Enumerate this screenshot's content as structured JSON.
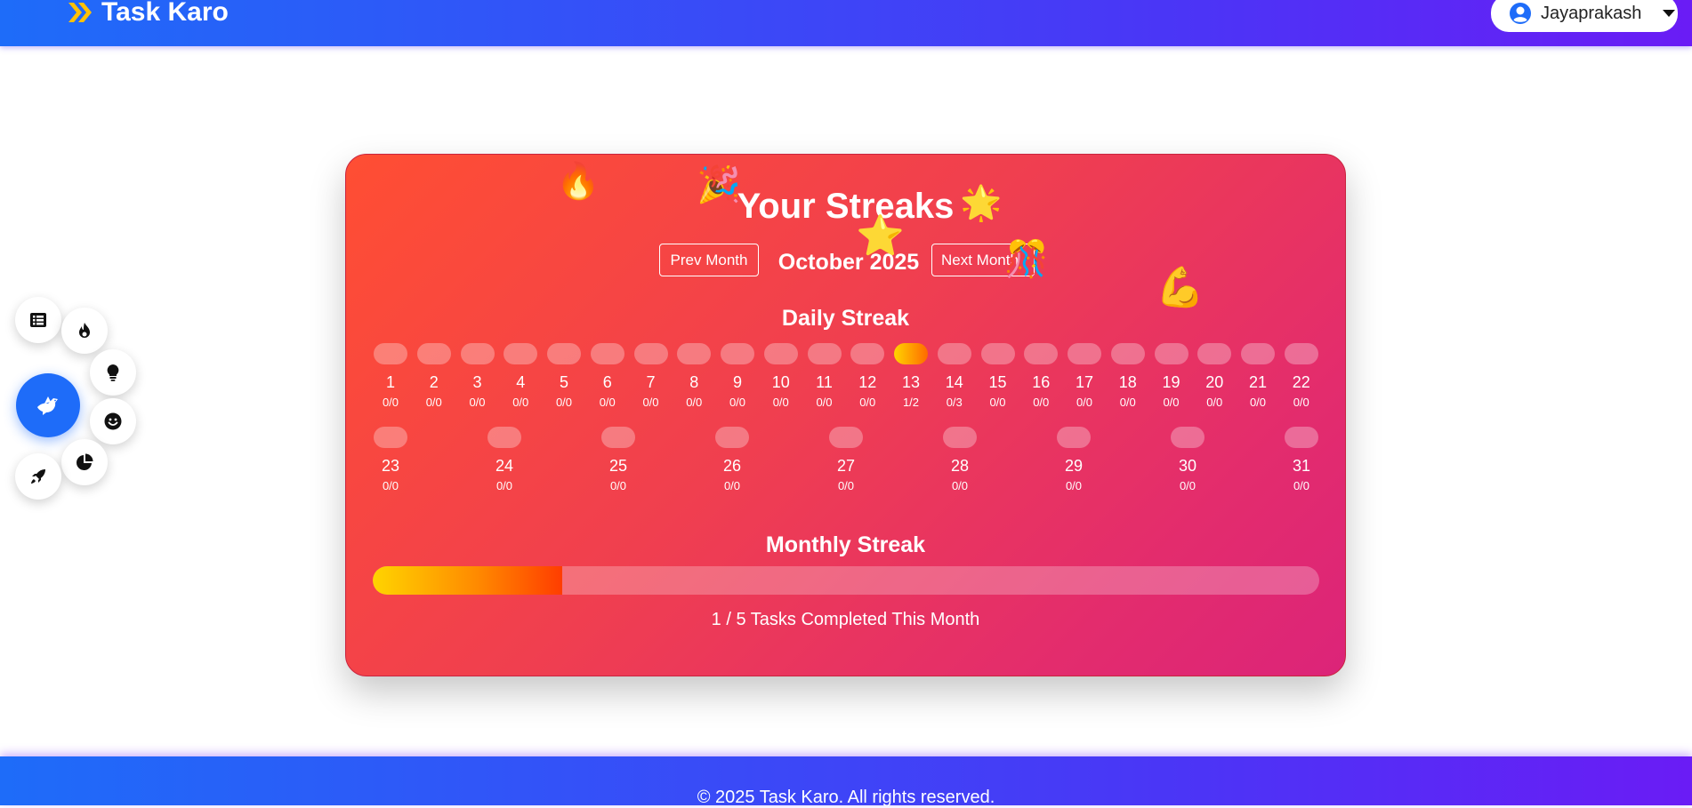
{
  "header": {
    "brand": "Task Karo",
    "user_name": "Jayaprakash",
    "icons": {
      "logo": "chevrons-logo-icon",
      "user": "user-circle-icon",
      "dropdown": "caret-down-icon"
    }
  },
  "streaks": {
    "title": "Your Streaks",
    "prev_label": "Prev Month",
    "next_label": "Next Month",
    "month_label": "October 2025",
    "daily_title": "Daily Streak",
    "monthly_title": "Monthly Streak",
    "days": [
      {
        "day": "1",
        "count": "0/0",
        "active": false
      },
      {
        "day": "2",
        "count": "0/0",
        "active": false
      },
      {
        "day": "3",
        "count": "0/0",
        "active": false
      },
      {
        "day": "4",
        "count": "0/0",
        "active": false
      },
      {
        "day": "5",
        "count": "0/0",
        "active": false
      },
      {
        "day": "6",
        "count": "0/0",
        "active": false
      },
      {
        "day": "7",
        "count": "0/0",
        "active": false
      },
      {
        "day": "8",
        "count": "0/0",
        "active": false
      },
      {
        "day": "9",
        "count": "0/0",
        "active": false
      },
      {
        "day": "10",
        "count": "0/0",
        "active": false
      },
      {
        "day": "11",
        "count": "0/0",
        "active": false
      },
      {
        "day": "12",
        "count": "0/0",
        "active": false
      },
      {
        "day": "13",
        "count": "1/2",
        "active": true
      },
      {
        "day": "14",
        "count": "0/3",
        "active": false
      },
      {
        "day": "15",
        "count": "0/0",
        "active": false
      },
      {
        "day": "16",
        "count": "0/0",
        "active": false
      },
      {
        "day": "17",
        "count": "0/0",
        "active": false
      },
      {
        "day": "18",
        "count": "0/0",
        "active": false
      },
      {
        "day": "19",
        "count": "0/0",
        "active": false
      },
      {
        "day": "20",
        "count": "0/0",
        "active": false
      },
      {
        "day": "21",
        "count": "0/0",
        "active": false
      },
      {
        "day": "22",
        "count": "0/0",
        "active": false
      },
      {
        "day": "23",
        "count": "0/0",
        "active": false
      },
      {
        "day": "24",
        "count": "0/0",
        "active": false
      },
      {
        "day": "25",
        "count": "0/0",
        "active": false
      },
      {
        "day": "26",
        "count": "0/0",
        "active": false
      },
      {
        "day": "27",
        "count": "0/0",
        "active": false
      },
      {
        "day": "28",
        "count": "0/0",
        "active": false
      },
      {
        "day": "29",
        "count": "0/0",
        "active": false
      },
      {
        "day": "30",
        "count": "0/0",
        "active": false
      },
      {
        "day": "31",
        "count": "0/0",
        "active": false
      }
    ],
    "monthly_completed": 1,
    "monthly_total": 5,
    "monthly_progress_fraction": 0.2,
    "monthly_text": "1 / 5 Tasks Completed This Month",
    "decorations": [
      "fire-emoji",
      "party-popper-emoji",
      "star-emoji",
      "sparkle-star-emoji",
      "confetti-popper-emoji",
      "flexed-biceps-emoji"
    ]
  },
  "side_menu": {
    "items": [
      "list-icon",
      "fire-icon",
      "lightbulb-icon",
      "smile-icon",
      "pie-chart-icon",
      "rocket-icon"
    ],
    "main": "dove-icon"
  },
  "footer": {
    "text": "© 2025 Task Karo. All rights reserved."
  },
  "colors": {
    "nav_start": "#1e6cf9",
    "nav_end": "#6a1cf5",
    "card_start": "#ff4e33",
    "card_end": "#dc2479",
    "streak_active_start": "#ffd400",
    "streak_active_end": "#ff6a00",
    "fab_main": "#1e6cf9"
  }
}
